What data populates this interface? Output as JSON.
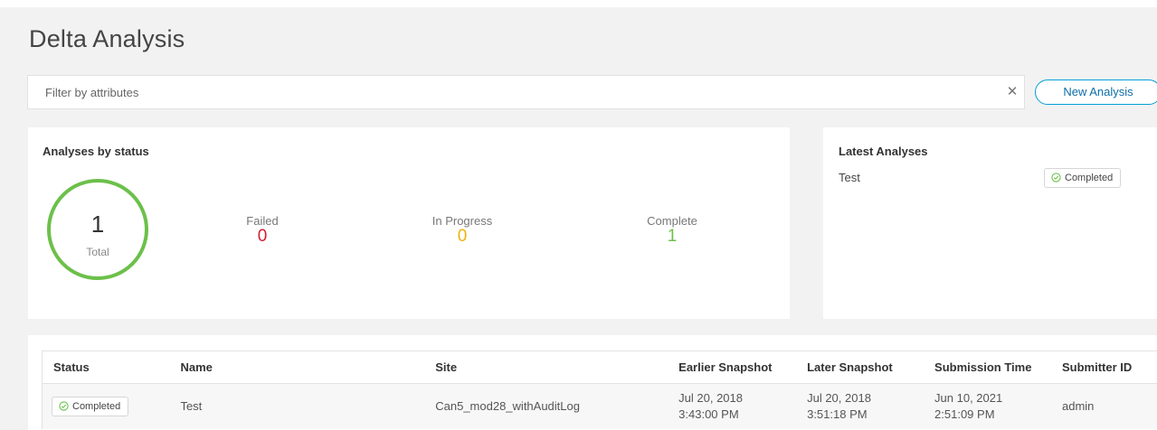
{
  "page": {
    "title": "Delta Analysis"
  },
  "filter": {
    "placeholder": "Filter by attributes",
    "clear_icon": "close-icon",
    "new_analysis_label": "New Analysis"
  },
  "status_summary": {
    "title": "Analyses by status",
    "total_value": "1",
    "total_label": "Total",
    "ring_color": "#6cc04a",
    "failed": {
      "label": "Failed",
      "value": "0",
      "color": "#cf2030"
    },
    "in_progress": {
      "label": "In Progress",
      "value": "0",
      "color": "#f0b20a"
    },
    "complete": {
      "label": "Complete",
      "value": "1",
      "color": "#6cc04a"
    }
  },
  "latest": {
    "title": "Latest Analyses",
    "items": [
      {
        "name": "Test",
        "status": "Completed",
        "status_icon": "check-circle-icon"
      }
    ]
  },
  "table": {
    "columns": [
      "Status",
      "Name",
      "Site",
      "Earlier Snapshot",
      "Later Snapshot",
      "Submission Time",
      "Submitter ID"
    ],
    "rows": [
      {
        "status": "Completed",
        "status_icon": "check-circle-icon",
        "name": "Test",
        "site": "Can5_mod28_withAuditLog",
        "earlier_date": "Jul 20, 2018",
        "earlier_time": "3:43:00 PM",
        "later_date": "Jul 20, 2018",
        "later_time": "3:51:18 PM",
        "submission_date": "Jun 10, 2021",
        "submission_time": "2:51:09 PM",
        "submitter": "admin"
      }
    ]
  },
  "colors": {
    "accent": "#049fd9",
    "success": "#6cc04a",
    "danger": "#cf2030",
    "warning": "#f0b20a"
  }
}
